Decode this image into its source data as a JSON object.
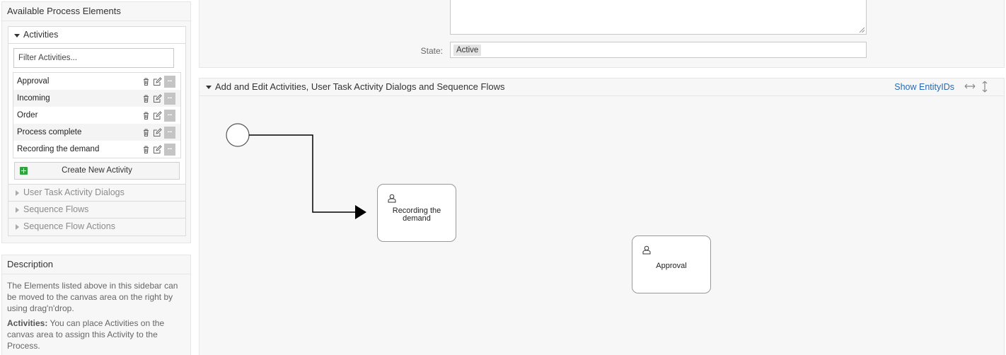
{
  "sidebar": {
    "available_title": "Available Process Elements",
    "activities_header": "Activities",
    "filter_placeholder": "Filter Activities...",
    "activities": [
      {
        "label": "Approval"
      },
      {
        "label": "Incoming"
      },
      {
        "label": "Order"
      },
      {
        "label": "Process complete"
      },
      {
        "label": "Recording the demand"
      }
    ],
    "dash_label": "--",
    "create_button": "Create New Activity",
    "sections": [
      {
        "label": "User Task Activity Dialogs"
      },
      {
        "label": "Sequence Flows"
      },
      {
        "label": "Sequence Flow Actions"
      }
    ],
    "description_title": "Description",
    "description_text": "The Elements listed above in this sidebar can be moved to the canvas area on the right by using drag'n'drop.",
    "activities_hint_label": "Activities:",
    "activities_hint_text": " You can place Activities on the canvas area to assign this Activity to the Process."
  },
  "props": {
    "state_label": "State:",
    "state_value": "Active"
  },
  "canvas": {
    "header": "Add and Edit Activities, User Task Activity Dialogs and Sequence Flows",
    "show_ids": "Show EntityIDs",
    "nodes": [
      {
        "label": "Recording the demand"
      },
      {
        "label": "Approval"
      }
    ]
  },
  "colors": {
    "link": "#2a6ab0",
    "create_icon": "#2fa33e"
  }
}
